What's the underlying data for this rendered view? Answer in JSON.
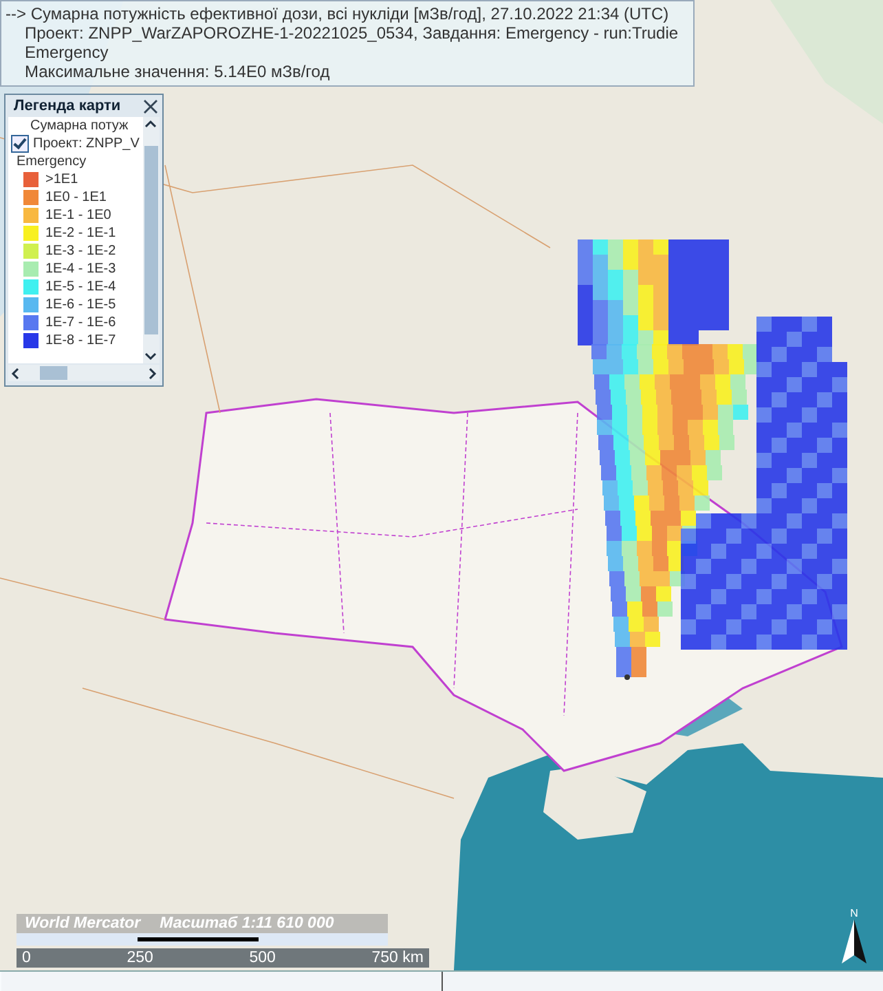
{
  "info_box": {
    "title": "--> Сумарна потужність ефективної дози, всі нукліди [мЗв/год], 27.10.2022 21:34 (UTC)",
    "project": "Проект: ZNPP_WarZAPOROZHE-1-20221025_0534, Завдання: Emergency - run:Trudie Emergency",
    "maximum": "Максимальне значення: 5.14E0 мЗв/год"
  },
  "legend": {
    "title": "Легенда карти",
    "layer": "Сумарна потуж",
    "project": {
      "label": "Проект: ZNPP_V",
      "checked": true
    },
    "group": "Emergency",
    "items": [
      {
        "label": ">1E1",
        "color": "#e8603a"
      },
      {
        "label": "1E0 - 1E1",
        "color": "#f08838"
      },
      {
        "label": "1E-1 - 1E0",
        "color": "#f8b840"
      },
      {
        "label": "1E-2 - 1E-1",
        "color": "#f8f020"
      },
      {
        "label": "1E-3 - 1E-2",
        "color": "#d0f050"
      },
      {
        "label": "1E-4 - 1E-3",
        "color": "#a8ecb0"
      },
      {
        "label": "1E-5 - 1E-4",
        "color": "#40f0f0"
      },
      {
        "label": "1E-6 - 1E-5",
        "color": "#58b8f0"
      },
      {
        "label": "1E-7 - 1E-6",
        "color": "#5878f0"
      },
      {
        "label": "1E-8 - 1E-7",
        "color": "#2838e8"
      }
    ]
  },
  "scale": {
    "projection": "World Mercator",
    "ratio": "Масштаб 1:11 610 000",
    "ticks": [
      "0",
      "250",
      "500",
      "750 km"
    ]
  },
  "north_label": "N"
}
